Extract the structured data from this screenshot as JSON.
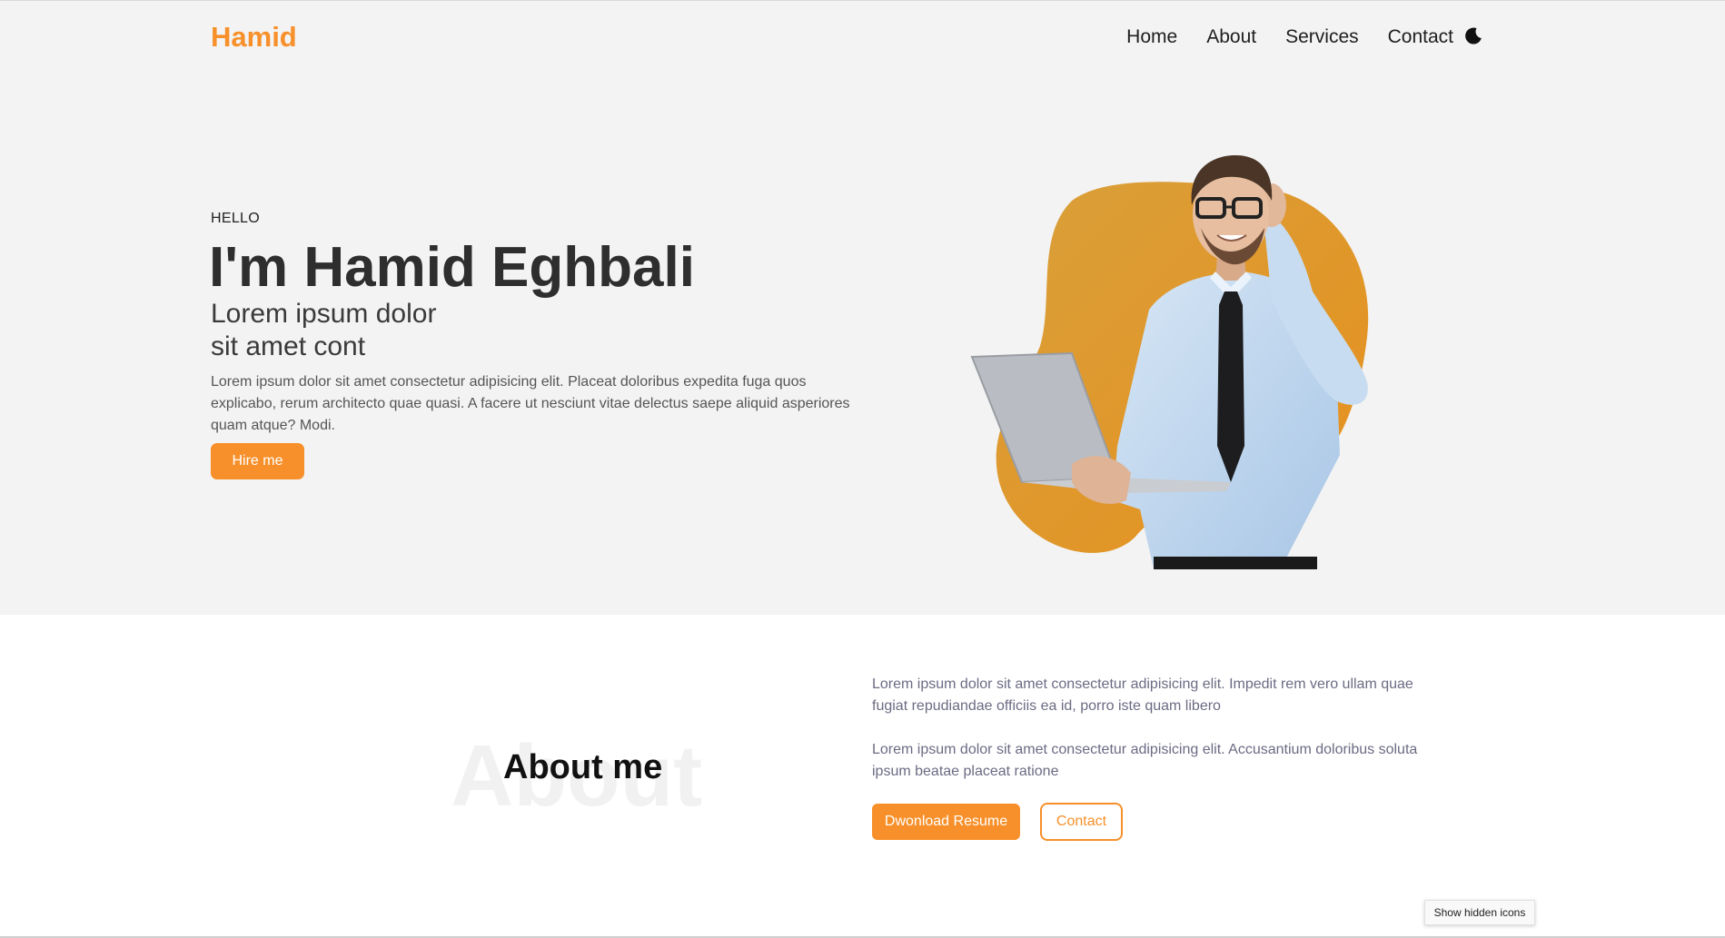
{
  "nav": {
    "logo": "Hamid",
    "links": [
      "Home",
      "About",
      "Services",
      "Contact"
    ],
    "theme_icon": "moon-icon"
  },
  "hero": {
    "greeting": "HELLO",
    "name": "I'm Hamid Eghbali",
    "subtitle_line1": "Lorem ipsum dolor",
    "subtitle_line2": "sit amet cont",
    "description": "Lorem ipsum dolor sit amet consectetur adipisicing elit. Placeat doloribus expedita fuga quos explicabo, rerum architecto quae quasi. A facere ut nesciunt vitae delectus saepe aliquid asperiores quam atque? Modi.",
    "hire_button": "Hire me",
    "image": "man-with-laptop-photo"
  },
  "about": {
    "background_word": "About",
    "title": "About me",
    "paragraph1": "Lorem ipsum dolor sit amet consectetur adipisicing elit. Impedit rem vero ullam quae fugiat repudiandae officiis ea id, porro iste quam libero",
    "paragraph2": "Lorem ipsum dolor sit amet consectetur adipisicing elit. Accusantium doloribus soluta ipsum beatae placeat ratione",
    "resume_button": "Dwonload Resume",
    "contact_button": "Contact"
  },
  "system": {
    "tooltip": "Show hidden icons"
  },
  "colors": {
    "accent": "#f7902a",
    "hero_background": "#f3f3f3",
    "body_text": "#6b6b84"
  }
}
